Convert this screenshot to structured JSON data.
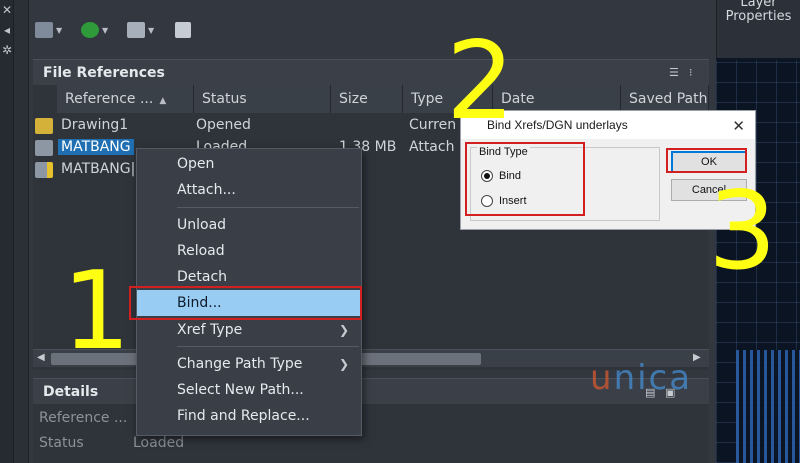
{
  "left_strip": {
    "icons": [
      "close-icon",
      "pin-icon",
      "settings-icon"
    ]
  },
  "toolbar": {
    "buttons": [
      {
        "icon": "attach-dwg-icon",
        "has_dropdown": true
      },
      {
        "icon": "refresh-icon",
        "has_dropdown": true
      },
      {
        "icon": "change-path-icon",
        "has_dropdown": true
      },
      {
        "icon": "help-icon",
        "has_dropdown": false
      }
    ]
  },
  "file_references": {
    "title": "File References",
    "columns": [
      "Reference ...",
      "Status",
      "Size",
      "Type",
      "Date",
      "Saved Path"
    ],
    "rows": [
      {
        "name": "Drawing1",
        "status": "Opened",
        "size": "",
        "type": "Curren",
        "icon": "drawing-icon"
      },
      {
        "name": "MATBANG",
        "status": "Loaded",
        "size": "1.38 MB",
        "type": "Attach",
        "icon": "xref-icon",
        "selected": true
      },
      {
        "name": "MATBANG|L",
        "status": "",
        "size": "",
        "type": "",
        "icon": "xref-warning-icon"
      }
    ]
  },
  "details": {
    "title": "Details",
    "fields": [
      {
        "label": "Reference ...",
        "value": ""
      },
      {
        "label": "Status",
        "value": "Loaded"
      }
    ]
  },
  "context_menu": {
    "items": [
      {
        "label": "Open"
      },
      {
        "label": "Attach..."
      },
      {
        "label": "Unload"
      },
      {
        "label": "Reload"
      },
      {
        "label": "Detach"
      },
      {
        "label": "Bind...",
        "highlighted": true
      },
      {
        "label": "Xref Type",
        "submenu": true
      },
      {
        "label": "Change Path Type",
        "submenu": true
      },
      {
        "label": "Select New Path..."
      },
      {
        "label": "Find and Replace..."
      }
    ]
  },
  "dialog": {
    "title": "Bind Xrefs/DGN underlays",
    "group_label": "Bind Type",
    "options": [
      {
        "label": "Bind",
        "selected": true
      },
      {
        "label": "Insert",
        "selected": false
      }
    ],
    "ok_label": "OK",
    "cancel_label": "Cancel"
  },
  "right_panel": {
    "layer_label": "Layer Properties"
  },
  "annotations": {
    "step1": "1",
    "step2": "2",
    "step3": "3"
  },
  "watermark": {
    "first": "u",
    "rest": "nica"
  },
  "colors": {
    "step_yellow": "#ffff14",
    "highlight_red": "#d21f1f",
    "menu_highlight": "#99ccf3",
    "selection_blue": "#1f6fb2"
  }
}
